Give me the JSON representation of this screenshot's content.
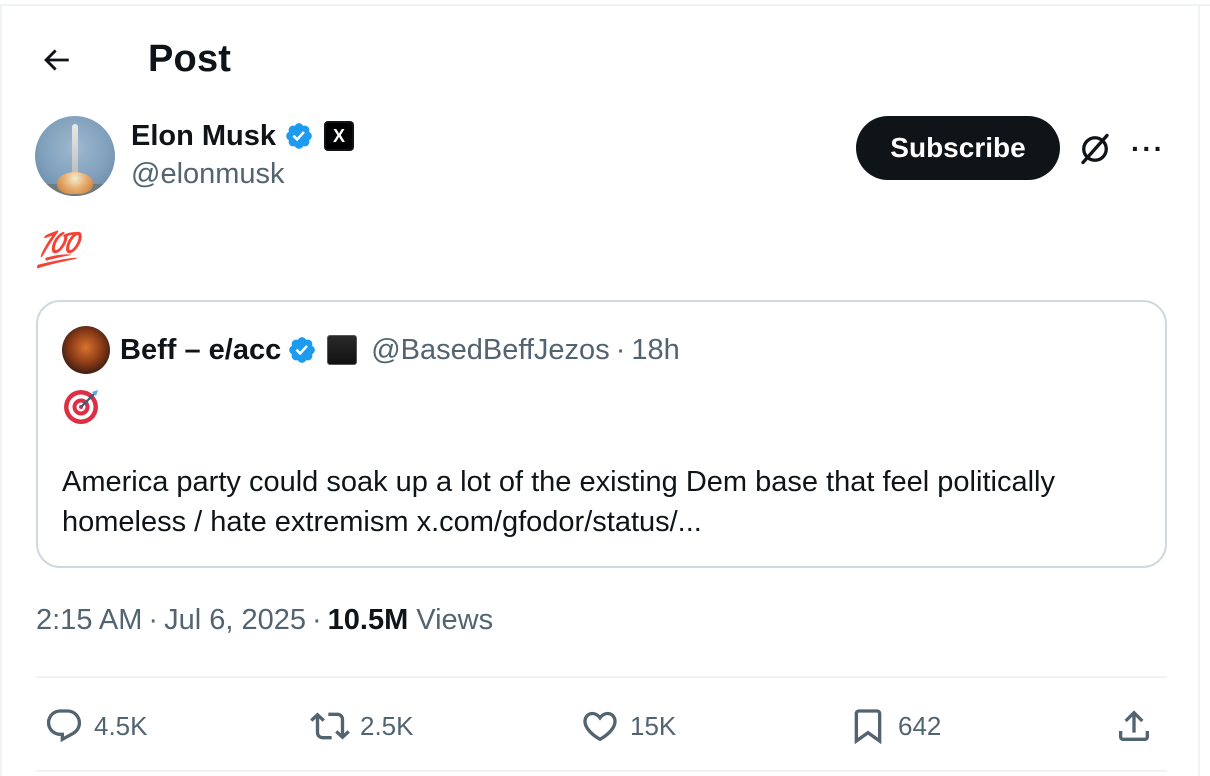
{
  "header": {
    "title": "Post"
  },
  "author": {
    "name": "Elon Musk",
    "handle": "@elonmusk",
    "affiliation_badge": "X"
  },
  "actions_top": {
    "subscribe_label": "Subscribe",
    "more_label": "···"
  },
  "post": {
    "text": "💯"
  },
  "quote": {
    "name": "Beff – e/acc",
    "handle": "@BasedBeffJezos",
    "separator": "·",
    "time": "18h",
    "emoji": "🎯",
    "text": "America party could soak up a lot of the existing Dem base that feel politically homeless / hate extremism x.com/gfodor/status/..."
  },
  "meta": {
    "time": "2:15 AM",
    "sep1": "·",
    "date": "Jul 6, 2025",
    "sep2": "·",
    "views_count": "10.5M",
    "views_label": "Views"
  },
  "stats": {
    "replies": "4.5K",
    "reposts": "2.5K",
    "likes": "15K",
    "bookmarks": "642"
  },
  "colors": {
    "accent": "#1d9bf0",
    "text": "#0f1419",
    "secondary": "#536471",
    "border": "#cfd9de"
  }
}
